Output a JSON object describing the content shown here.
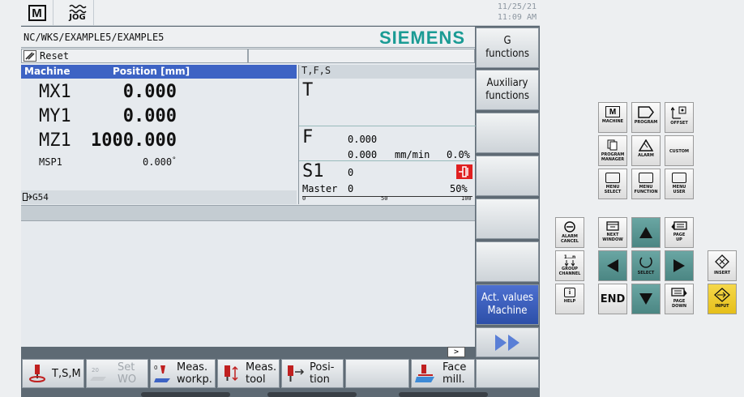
{
  "header": {
    "mode_icon": "M",
    "jog": "JOG",
    "date": "11/25/21",
    "time": "11:09 AM"
  },
  "program": {
    "path": "NC/WKS/EXAMPLE5/EXAMPLE5",
    "logo": "SIEMENS",
    "status": "Reset"
  },
  "machine": {
    "col1": "Machine",
    "col2": "Position [mm]",
    "axes": [
      {
        "name": "MX1",
        "value": "0.000"
      },
      {
        "name": "MY1",
        "value": "0.000"
      },
      {
        "name": "MZ1",
        "value": "1000.000"
      }
    ],
    "spindle_name": "MSP1",
    "spindle_value": "0.000",
    "spindle_unit": "°",
    "frame": "G54"
  },
  "tfs": {
    "title": "T,F,S",
    "t_label": "T",
    "f_label": "F",
    "f_value1": "0.000",
    "f_value2": "0.000",
    "f_unit": "mm/min",
    "f_pct": "0.0%",
    "s_label": "S1",
    "s_value": "0",
    "master_label": "Master",
    "master_value": "0",
    "master_pct": "50%",
    "scale": [
      "0",
      "50",
      "100"
    ],
    "load_level_pct": 0
  },
  "softkeys_vertical": [
    {
      "label": "G\nfunctions"
    },
    {
      "label": "Auxiliary\nfunctions"
    },
    {
      "label": ""
    },
    {
      "label": ""
    },
    {
      "label": ""
    },
    {
      "label": ""
    },
    {
      "label": "Act. values\nMachine",
      "active": true
    },
    {
      "label": "",
      "icon": "double-arrow-right-icon"
    },
    {
      "label": ""
    }
  ],
  "softkeys_horizontal": [
    {
      "label": "T,S,M"
    },
    {
      "label": "Set\nWO",
      "disabled": true
    },
    {
      "label": "Meas.\nworkp."
    },
    {
      "label": "Meas.\ntool"
    },
    {
      "label": "Posi-\ntion"
    },
    {
      "label": ""
    },
    {
      "label": "Face\nmill."
    }
  ],
  "scroll_indicator": ">",
  "keypad": {
    "machine": "MACHINE",
    "program": "PROGRAM",
    "offset": "OFFSET",
    "program_manager": "PROGRAM\nMANAGER",
    "alarm": "ALARM",
    "custom": "CUSTOM",
    "menu_select": "MENU\nSELECT",
    "menu_function": "MENU\nFUNCTION",
    "menu_user": "MENU\nUSER",
    "alarm_cancel": "ALARM\nCANCEL",
    "next_window": "NEXT\nWINDOW",
    "page_up": "PAGE\nUP",
    "group_channel": "GROUP\nCHANNEL",
    "select": "SELECT",
    "help": "HELP",
    "end": "END",
    "page_down": "PAGE\nDOWN",
    "insert": "INSERT",
    "input": "INPUT",
    "channel_counter": "1…n"
  }
}
